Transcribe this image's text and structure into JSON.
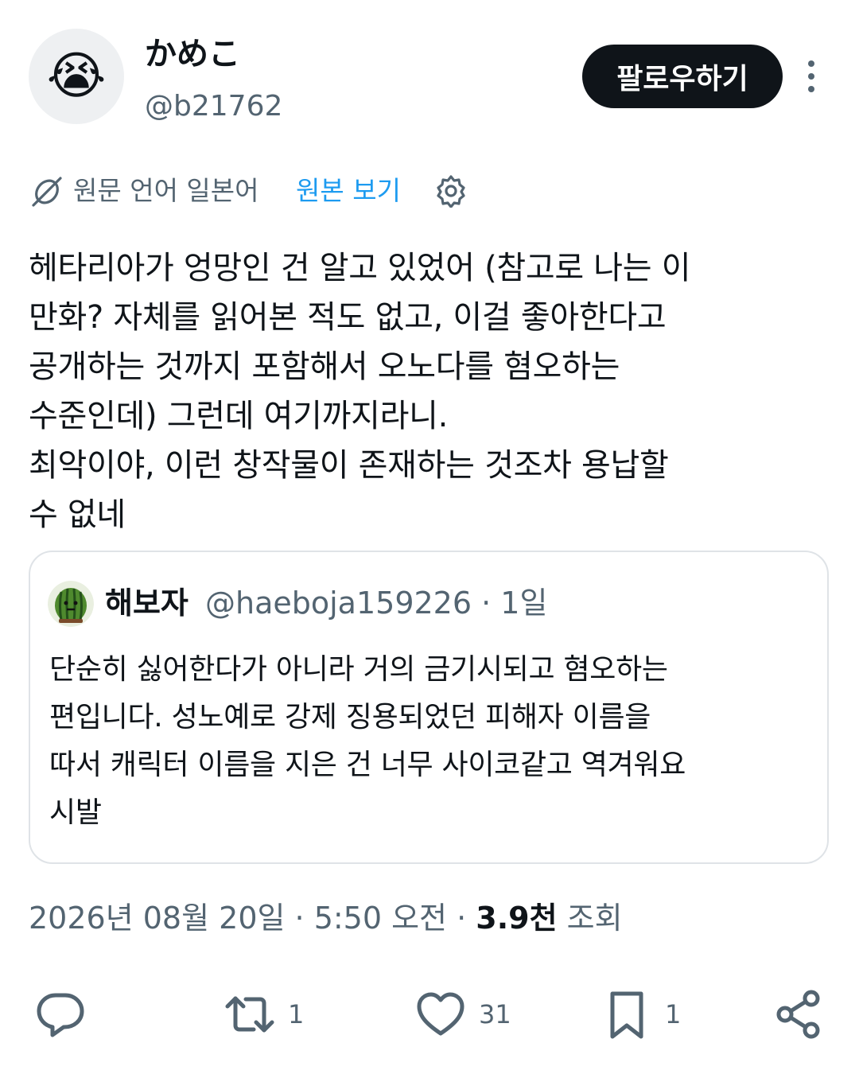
{
  "author": {
    "name": "かめこ",
    "handle": "@b21762",
    "avatar_emoji": "😭"
  },
  "follow_label": "팔로우하기",
  "translation": {
    "language_note": "원문 언어 일본어",
    "show_original": "원본 보기"
  },
  "tweet_text": "헤타리아가 엉망인 건 알고 있었어 (참고로 나는 이\n만화? 자체를 읽어본 적도 없고, 이걸 좋아한다고\n공개하는 것까지 포함해서 오노다를 혐오하는\n수준인데) 그런데 여기까지라니.\n최악이야, 이런 창작물이 존재하는 것조차 용납할\n수 없네",
  "quote": {
    "name": "해보자",
    "handle_time": "@haeboja159226 · 1일",
    "text": "단순히 싫어한다가 아니라 거의 금기시되고 혐오하는\n편입니다. 성노예로 강제 징용되었던 피해자 이름을\n따서 캐릭터 이름을 지은 건 너무 사이코같고 역겨워요\n시발"
  },
  "meta": {
    "datetime": "2026년 08월 20일 · 5:50 오전 · ",
    "views_count": "3.9천",
    "views_label": " 조회"
  },
  "actions": {
    "reply_count": "",
    "retweet_count": "1",
    "like_count": "31",
    "bookmark_count": "1"
  },
  "colors": {
    "accent": "#1d9bf0",
    "text": "#0f1419",
    "secondary": "#536471",
    "border": "#dfe3e7"
  }
}
